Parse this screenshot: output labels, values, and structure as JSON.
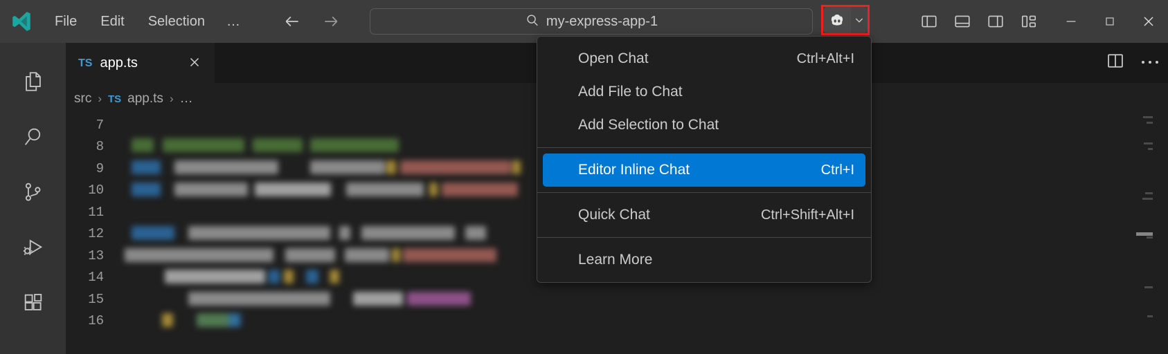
{
  "window": {
    "title_bar_bg": "#3c3c3c",
    "editor_bg": "#1f1f1f",
    "accent": "#0078d4",
    "highlight_outline": "#f02020"
  },
  "menubar": {
    "items": [
      {
        "label": "File",
        "name": "menubar-file"
      },
      {
        "label": "Edit",
        "name": "menubar-edit"
      },
      {
        "label": "Selection",
        "name": "menubar-selection"
      }
    ],
    "overflow_label": "…"
  },
  "navigation": {
    "back_icon": "arrow-left-icon",
    "forward_icon": "arrow-right-icon"
  },
  "search": {
    "icon": "search-icon",
    "value": "my-express-app-1",
    "placeholder": "Search"
  },
  "copilot": {
    "icon": "copilot-icon",
    "chevron_icon": "chevron-down-icon",
    "highlighted": true
  },
  "layout_controls": [
    {
      "label": "Toggle Primary Side Bar",
      "icon": "layout-sidebar-left-icon"
    },
    {
      "label": "Toggle Panel",
      "icon": "layout-panel-icon"
    },
    {
      "label": "Toggle Secondary Side Bar",
      "icon": "layout-sidebar-right-icon"
    },
    {
      "label": "Customize Layout",
      "icon": "layout-customize-icon"
    }
  ],
  "window_controls": [
    {
      "label": "Minimize",
      "icon": "minimize-icon"
    },
    {
      "label": "Maximize",
      "icon": "maximize-icon"
    },
    {
      "label": "Close",
      "icon": "close-icon"
    }
  ],
  "activity_bar": [
    {
      "label": "Explorer",
      "icon": "files-icon"
    },
    {
      "label": "Search",
      "icon": "search-icon"
    },
    {
      "label": "Source Control",
      "icon": "source-control-icon"
    },
    {
      "label": "Run and Debug",
      "icon": "run-debug-icon"
    },
    {
      "label": "Extensions",
      "icon": "extensions-icon"
    }
  ],
  "tab": {
    "badge": "TS",
    "title": "app.ts",
    "close_icon": "close-icon"
  },
  "editor_actions": [
    {
      "label": "Split Editor Right",
      "icon": "split-editor-icon"
    },
    {
      "label": "More Actions...",
      "icon": "ellipsis-icon"
    }
  ],
  "breadcrumbs": {
    "items": [
      "src",
      "app.ts",
      "…"
    ],
    "badge": "TS",
    "separator": "›"
  },
  "code": {
    "line_numbers": [
      7,
      8,
      9,
      10,
      11,
      12,
      13,
      14,
      15,
      16
    ],
    "blurred": true
  },
  "context_menu": {
    "groups": [
      {
        "items": [
          {
            "label": "Open Chat",
            "shortcut": "Ctrl+Alt+I",
            "selected": false
          },
          {
            "label": "Add File to Chat",
            "shortcut": "",
            "selected": false
          },
          {
            "label": "Add Selection to Chat",
            "shortcut": "",
            "selected": false
          }
        ]
      },
      {
        "items": [
          {
            "label": "Editor Inline Chat",
            "shortcut": "Ctrl+I",
            "selected": true
          }
        ]
      },
      {
        "items": [
          {
            "label": "Quick Chat",
            "shortcut": "Ctrl+Shift+Alt+I",
            "selected": false
          }
        ]
      },
      {
        "items": [
          {
            "label": "Learn More",
            "shortcut": "",
            "selected": false
          }
        ]
      }
    ]
  }
}
